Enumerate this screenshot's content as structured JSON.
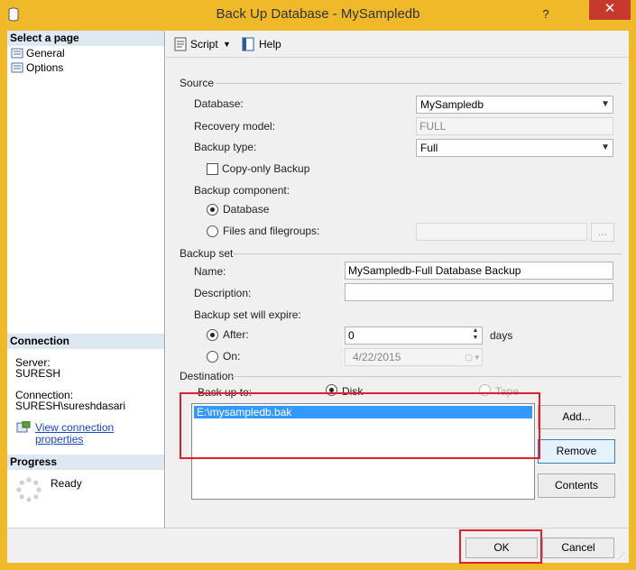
{
  "window": {
    "title": "Back Up Database - MySampledb",
    "help_glyph": "?",
    "close_glyph": "✕"
  },
  "left": {
    "select_page_header": "Select a page",
    "pages": [
      "General",
      "Options"
    ],
    "connection_header": "Connection",
    "server_label": "Server:",
    "server_value": "SURESH",
    "connection_label": "Connection:",
    "connection_value": "SURESH\\sureshdasari",
    "view_link": "View connection properties",
    "progress_header": "Progress",
    "progress_status": "Ready"
  },
  "toolbar": {
    "script_label": "Script",
    "help_label": "Help"
  },
  "source": {
    "group_label": "Source",
    "database_label": "Database:",
    "database_value": "MySampledb",
    "recovery_label": "Recovery model:",
    "recovery_value": "FULL",
    "backup_type_label": "Backup type:",
    "backup_type_value": "Full",
    "copy_only_label": "Copy-only Backup",
    "component_label": "Backup component:",
    "database_option": "Database",
    "files_option": "Files and filegroups:",
    "files_button": "..."
  },
  "backup_set": {
    "group_label": "Backup set",
    "name_label": "Name:",
    "name_value": "MySampledb-Full Database Backup",
    "description_label": "Description:",
    "description_value": "",
    "expire_label": "Backup set will expire:",
    "after_label": "After:",
    "after_value": "0",
    "days_label": "days",
    "on_label": "On:",
    "on_value": "4/22/2015"
  },
  "destination": {
    "group_label": "Destination",
    "backup_to_label": "Back up to:",
    "disk_label": "Disk",
    "tape_label": "Tape",
    "files": [
      "E:\\mysampledb.bak"
    ],
    "add_button": "Add...",
    "remove_button": "Remove",
    "contents_button": "Contents"
  },
  "footer": {
    "ok_button": "OK",
    "cancel_button": "Cancel"
  },
  "colors": {
    "title_bar": "#f0b92a",
    "close": "#c7392c",
    "highlight": "#e0202a",
    "selection": "#3399ff"
  }
}
